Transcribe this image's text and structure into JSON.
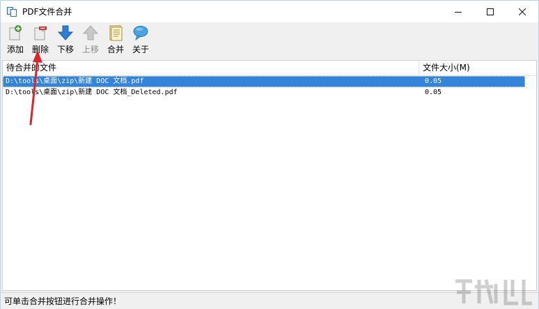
{
  "window": {
    "title": "PDF文件合并"
  },
  "toolbar": {
    "add_label": "添加",
    "delete_label": "删除",
    "move_down_label": "下移",
    "move_up_label": "上移",
    "merge_label": "合并",
    "about_label": "关于"
  },
  "list": {
    "columns": {
      "file": "待合并的文件",
      "size": "文件大小(M)"
    },
    "rows": [
      {
        "path": "D:\\tools\\桌面\\zip\\新建 DOC 文档.pdf",
        "size": "0.05",
        "selected": true
      },
      {
        "path": "D:\\tools\\桌面\\zip\\新建 DOC 文档_Deleted.pdf",
        "size": "0.05",
        "selected": false
      }
    ]
  },
  "status": {
    "text": "可单击合并按钮进行合并操作！"
  },
  "colors": {
    "selection": "#3584db",
    "annotation_arrow": "#d9262c",
    "move_arrow_blue": "#2f7fd2",
    "disabled_gray": "#8a8a8a"
  }
}
